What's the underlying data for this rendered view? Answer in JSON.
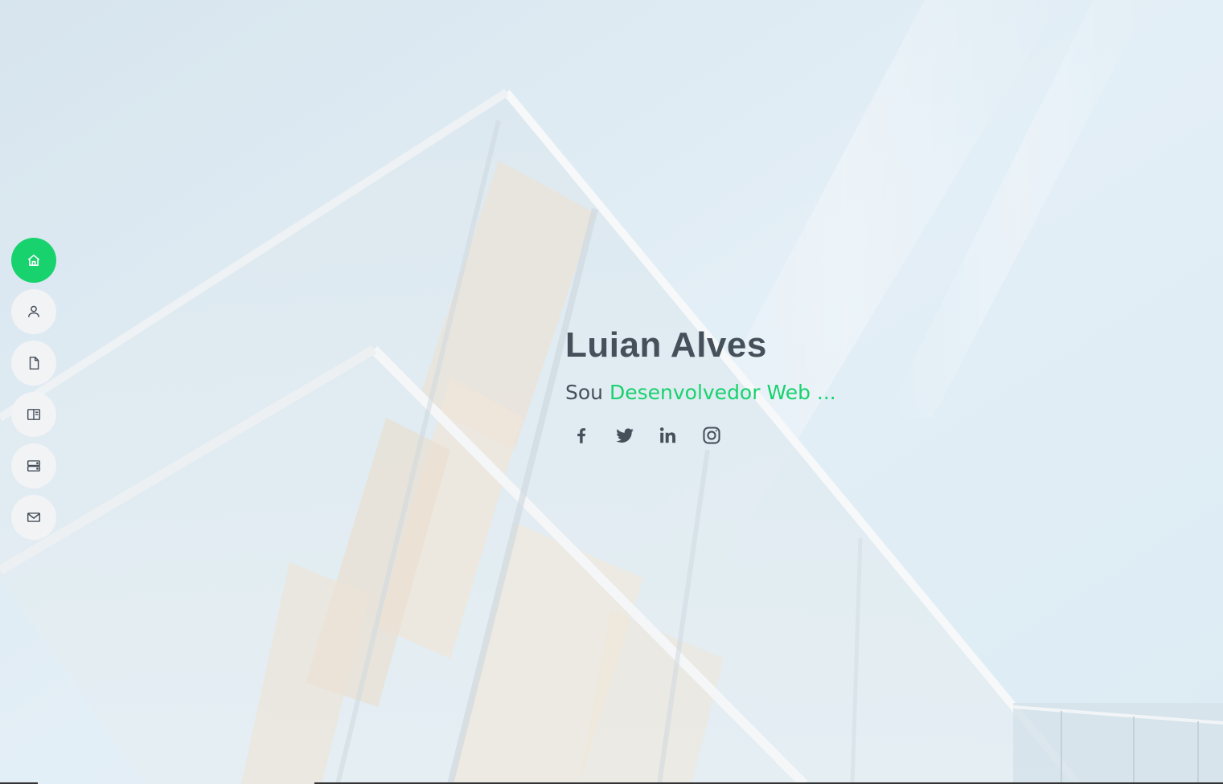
{
  "hero": {
    "name": "Luian Alves",
    "intro_prefix": "Sou",
    "typed_role": "Desenvolvedor Web ..."
  },
  "nav": {
    "items": [
      {
        "icon": "home-icon",
        "active": true
      },
      {
        "icon": "person-icon",
        "active": false
      },
      {
        "icon": "file-icon",
        "active": false
      },
      {
        "icon": "book-icon",
        "active": false
      },
      {
        "icon": "server-icon",
        "active": false
      },
      {
        "icon": "envelope-icon",
        "active": false
      }
    ]
  },
  "social": {
    "items": [
      {
        "icon": "facebook-icon"
      },
      {
        "icon": "twitter-icon"
      },
      {
        "icon": "linkedin-icon"
      },
      {
        "icon": "instagram-icon"
      }
    ]
  },
  "colors": {
    "accent": "#18d26e",
    "text": "#45505b",
    "nav_bg": "#f2f3f5"
  }
}
